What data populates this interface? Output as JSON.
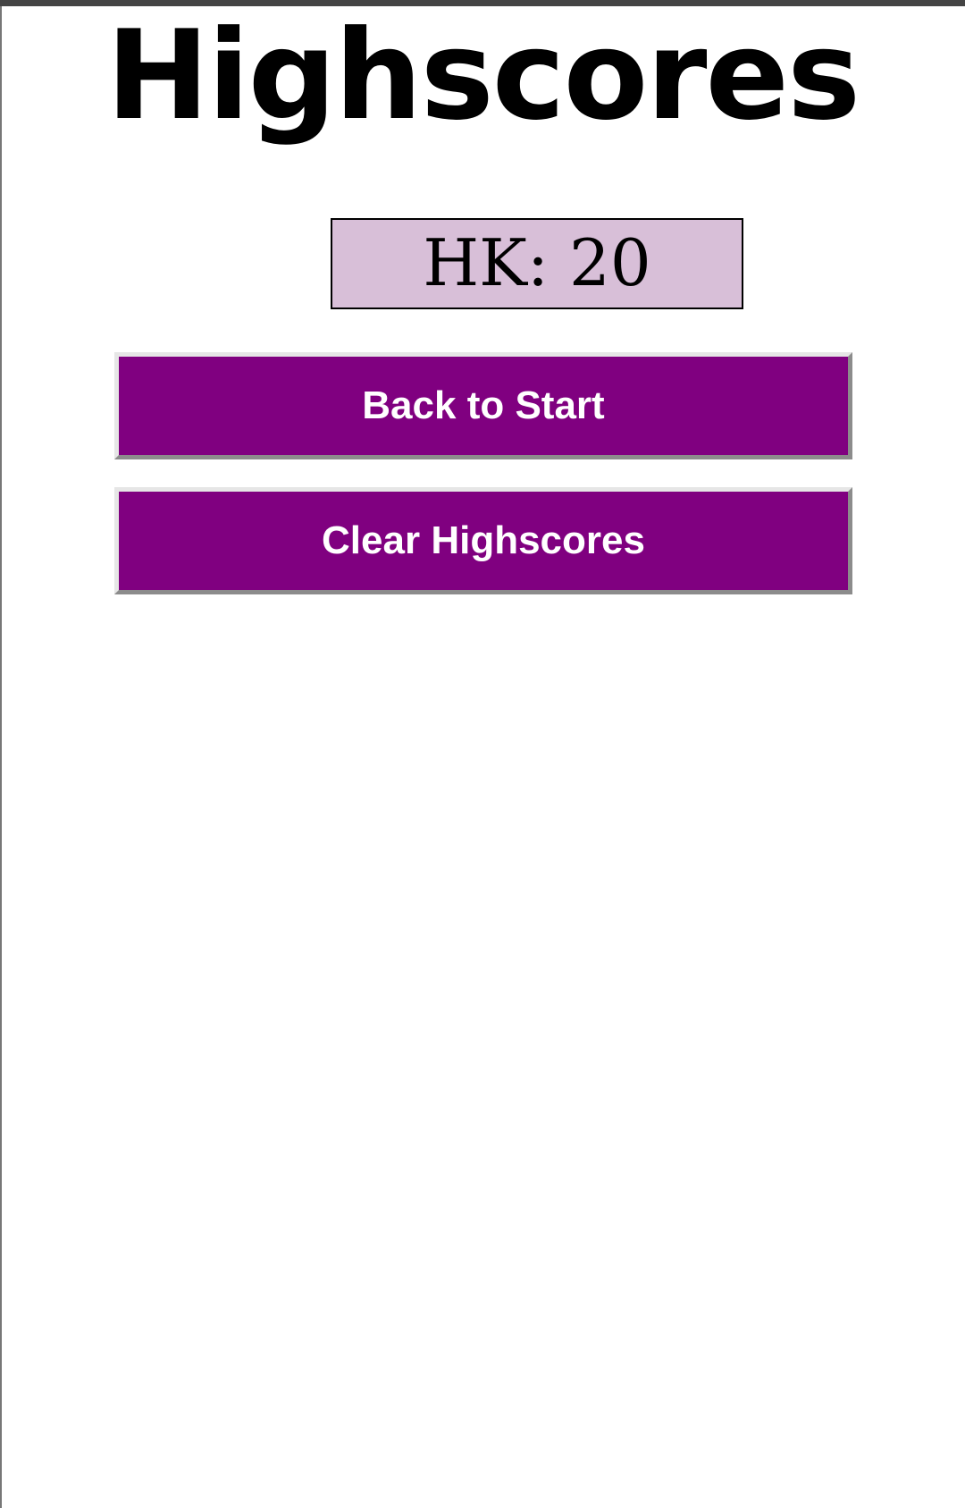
{
  "page": {
    "title": "Highscores"
  },
  "highscores": [
    {
      "text": "HK: 20"
    }
  ],
  "buttons": {
    "back_label": "Back to Start",
    "clear_label": "Clear Highscores"
  },
  "colors": {
    "button_background": "#800080",
    "score_background": "#d8bfd8",
    "page_background": "#ffffff"
  }
}
